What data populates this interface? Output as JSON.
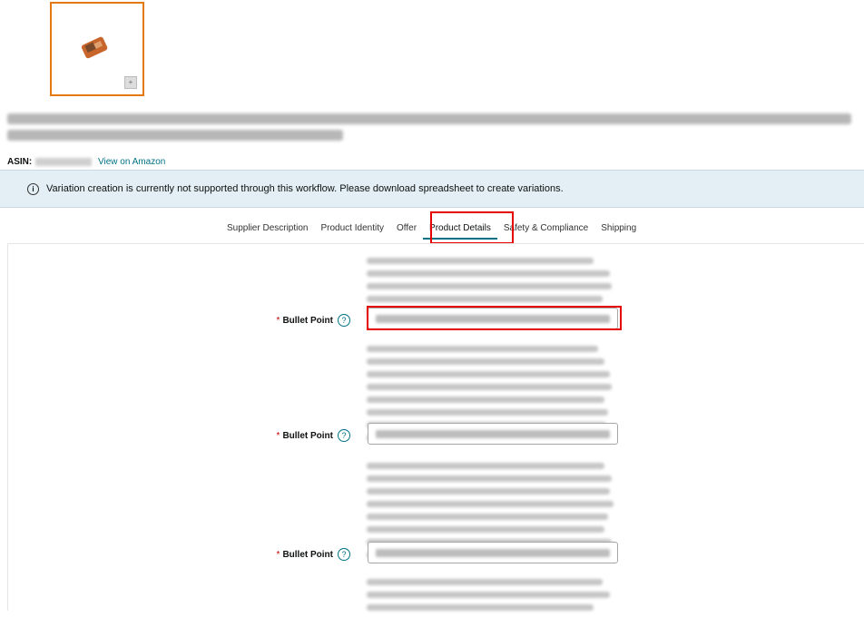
{
  "product": {
    "asin_label": "ASIN:",
    "view_link": "View on Amazon"
  },
  "banner": {
    "message": "Variation creation is currently not supported through this workflow. Please download spreadsheet to create variations."
  },
  "tabs": [
    {
      "label": "Supplier Description"
    },
    {
      "label": "Product Identity"
    },
    {
      "label": "Offer"
    },
    {
      "label": "Product Details",
      "active": true
    },
    {
      "label": "Safety & Compliance"
    },
    {
      "label": "Shipping"
    }
  ],
  "fields": [
    {
      "label": "Bullet Point",
      "required_marker": "*",
      "help_glyph": "?"
    },
    {
      "label": "Bullet Point",
      "required_marker": "*",
      "help_glyph": "?"
    },
    {
      "label": "Bullet Point",
      "required_marker": "*",
      "help_glyph": "?"
    }
  ],
  "colors": {
    "highlight": "#e60000",
    "accent": "#007185",
    "thumb_border": "#e47911",
    "banner_bg": "#e3eff5"
  }
}
